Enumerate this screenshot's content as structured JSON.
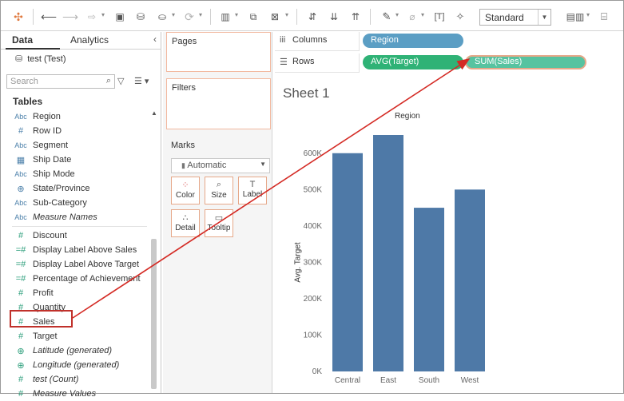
{
  "toolbar": {
    "standard_label": "Standard"
  },
  "left_pane": {
    "tabs": [
      {
        "label": "Data"
      },
      {
        "label": "Analytics"
      }
    ],
    "datasource": "test (Test)",
    "search_placeholder": "Search",
    "tables_heading": "Tables",
    "fields": [
      {
        "type": "Abc",
        "label": "Region",
        "italic": false
      },
      {
        "type": "#",
        "label": "Row ID",
        "italic": false
      },
      {
        "type": "Abc",
        "label": "Segment",
        "italic": false
      },
      {
        "type": "date",
        "label": "Ship Date",
        "italic": false
      },
      {
        "type": "Abc",
        "label": "Ship Mode",
        "italic": false
      },
      {
        "type": "globe",
        "label": "State/Province",
        "italic": false
      },
      {
        "type": "Abc",
        "label": "Sub-Category",
        "italic": false
      },
      {
        "type": "Abc",
        "label": "Measure Names",
        "italic": true
      },
      {
        "type": "#",
        "label": "Discount",
        "italic": false
      },
      {
        "type": "=#",
        "label": "Display Label Above Sales",
        "italic": false
      },
      {
        "type": "=#",
        "label": "Display Label Above Target",
        "italic": false
      },
      {
        "type": "=#",
        "label": "Percentage of Achievement",
        "italic": false
      },
      {
        "type": "#",
        "label": "Profit",
        "italic": false
      },
      {
        "type": "#",
        "label": "Quantity",
        "italic": false
      },
      {
        "type": "#",
        "label": "Sales",
        "italic": false
      },
      {
        "type": "#",
        "label": "Target",
        "italic": false
      },
      {
        "type": "globe",
        "label": "Latitude (generated)",
        "italic": true
      },
      {
        "type": "globe",
        "label": "Longitude (generated)",
        "italic": true
      },
      {
        "type": "#",
        "label": "test (Count)",
        "italic": true
      },
      {
        "type": "#",
        "label": "Measure Values",
        "italic": true
      }
    ]
  },
  "cards": {
    "pages": "Pages",
    "filters": "Filters",
    "marks": "Marks",
    "marks_type": "Automatic",
    "mark_buttons": [
      {
        "label": "Color",
        "icon": "color-dots-icon",
        "glyph": "⁘"
      },
      {
        "label": "Size",
        "icon": "size-icon",
        "glyph": "⌕"
      },
      {
        "label": "Label",
        "icon": "label-icon",
        "glyph": "T"
      },
      {
        "label": "Detail",
        "icon": "detail-icon",
        "glyph": "∴"
      },
      {
        "label": "Tooltip",
        "icon": "tooltip-icon",
        "glyph": "▭"
      }
    ]
  },
  "shelves": {
    "columns_label": "Columns",
    "rows_label": "Rows",
    "columns_pills": [
      "Region"
    ],
    "rows_pills": [
      "AVG(Target)",
      "SUM(Sales)"
    ]
  },
  "sheet": {
    "title": "Sheet 1",
    "column_header": "Region"
  },
  "colors": {
    "bar": "#4e79a7",
    "annotation": "#d42a24",
    "dimension_pill": "#5b9ec4",
    "measure_pill": "#2fb276"
  },
  "chart_data": {
    "type": "bar",
    "categories": [
      "Central",
      "East",
      "South",
      "West"
    ],
    "series": [
      {
        "values": [
          600000,
          650000,
          450000,
          500000
        ]
      }
    ],
    "title": "Region",
    "xlabel": "",
    "ylabel": "Avg. Target",
    "ylim": [
      0,
      650000
    ],
    "y_ticks": [
      "0K",
      "100K",
      "200K",
      "300K",
      "400K",
      "500K",
      "600K"
    ],
    "grid": false
  }
}
